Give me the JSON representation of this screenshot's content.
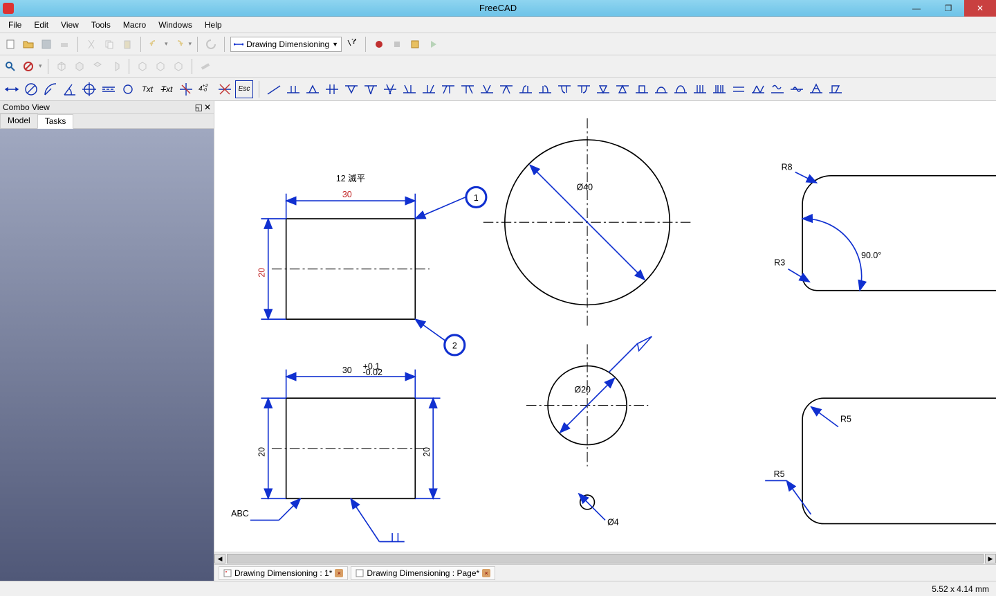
{
  "title": "FreeCAD",
  "menu": [
    "File",
    "Edit",
    "View",
    "Tools",
    "Macro",
    "Windows",
    "Help"
  ],
  "workbench": "Drawing Dimensioning",
  "comboview": {
    "title": "Combo View",
    "tabs": [
      "Model",
      "Tasks"
    ],
    "activeTab": "Tasks"
  },
  "doctabs": [
    "Drawing Dimensioning : 1*",
    "Drawing Dimensioning : Page*"
  ],
  "status": "5.52 x 4.14 mm",
  "drawing": {
    "box1": {
      "w": "30",
      "h": "20",
      "note_top": "12  滅平",
      "n1": "1",
      "n2": "2"
    },
    "box2": {
      "w": "30",
      "tolp": "+0.1",
      "tolm": "-0.02",
      "hL": "20",
      "hR": "20",
      "leader": "ABC"
    },
    "circ1": "Ø40",
    "circ2": "Ø20",
    "circ3": "Ø4",
    "fillet": {
      "r8": "R8",
      "r3": "R3",
      "ang": "90.0°",
      "r5a": "R5",
      "r5b": "R5"
    }
  }
}
